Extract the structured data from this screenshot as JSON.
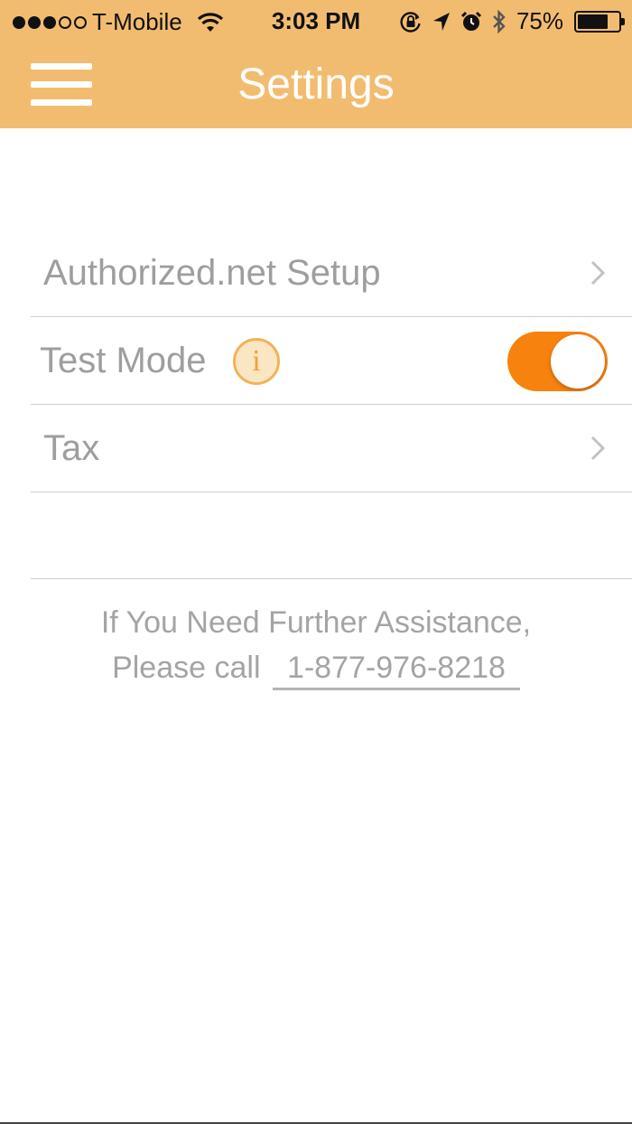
{
  "status_bar": {
    "carrier": "T-Mobile",
    "signal_bars_filled": 3,
    "signal_bars_total": 5,
    "time": "3:03 PM",
    "battery_percent_label": "75%",
    "battery_level": 0.75,
    "icons": [
      "wifi-icon",
      "rotation-lock-icon",
      "location-arrow-icon",
      "alarm-icon",
      "bluetooth-icon",
      "battery-icon"
    ]
  },
  "header": {
    "title": "Settings",
    "menu_icon": "hamburger-menu-icon",
    "background_color": "#f2bc70"
  },
  "settings": {
    "items": [
      {
        "label": "Authorized.net Setup",
        "trailing": "chevron-right-icon"
      },
      {
        "label": "Test Mode",
        "info_glyph": "i",
        "toggle_on": true,
        "toggle_color": "#f7820e"
      },
      {
        "label": "Tax",
        "trailing": "chevron-right-icon"
      }
    ]
  },
  "assistance": {
    "line1": "If You Need Further Assistance,",
    "line2_prefix": "Please call",
    "phone": "1-877-976-8218"
  }
}
